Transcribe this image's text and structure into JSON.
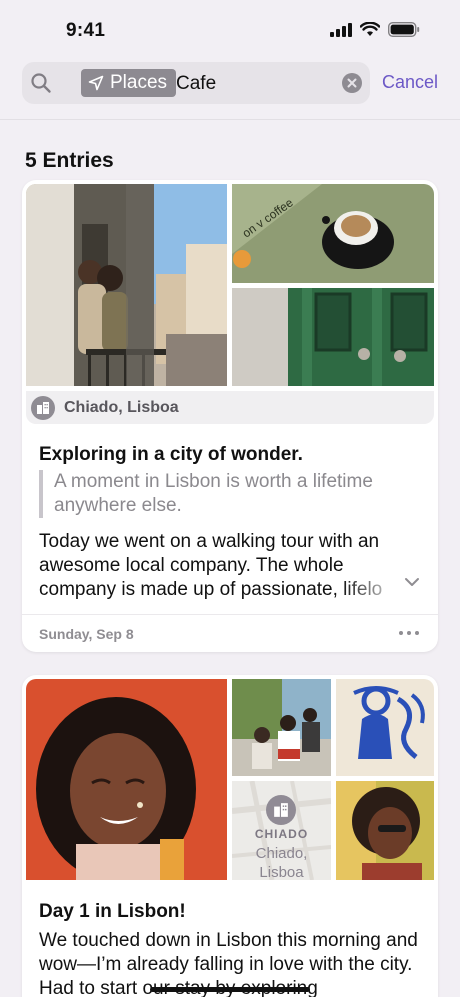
{
  "status_bar": {
    "time": "9:41"
  },
  "search": {
    "token_label": "Places",
    "query": "Cafe",
    "cancel_label": "Cancel"
  },
  "results": {
    "count_label": "5 Entries"
  },
  "entries": [
    {
      "location": "Chiado, Lisboa",
      "title": "Exploring in a city of wonder.",
      "quote": "A moment in Lisbon is worth a lifetime anywhere else.",
      "body": "Today we went on a walking tour with an awesome local company. The whole company is made up of passionate, lifelo",
      "date": "Sunday, Sep 8"
    },
    {
      "map_label_caps": "CHIADO",
      "map_label": "Chiado, Lisboa",
      "title": "Day 1 in Lisbon!",
      "body": "We touched down in Lisbon this morning and wow—I’m already falling in love with the city. Had to start our stay by exploring"
    }
  ],
  "colors": {
    "accent": "#6c58c6",
    "background": "#f2eff4",
    "card": "#ffffff",
    "secondary_text": "#8f8d92"
  },
  "icons": [
    "signal-icon",
    "wifi-icon",
    "battery-icon",
    "search-icon",
    "location-arrow-icon",
    "clear-icon",
    "building-icon",
    "chevron-down-icon",
    "more-icon"
  ]
}
